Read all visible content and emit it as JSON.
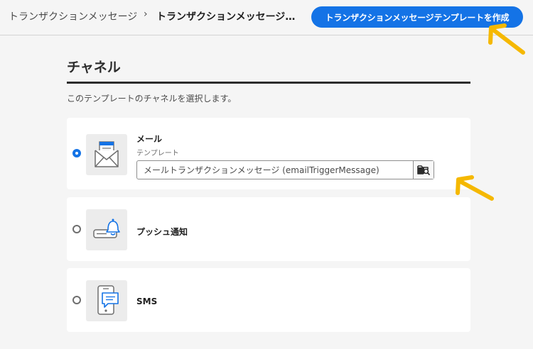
{
  "header": {
    "breadcrumb_root": "トランザクションメッセージ",
    "separator": "›",
    "breadcrumb_current": "トランザクションメッセージ...",
    "create_button_label": "トランザクションメッセージテンプレートを作成"
  },
  "section": {
    "title": "チャネル",
    "description": "このテンプレートのチャネルを選択します。"
  },
  "channels": [
    {
      "label": "メール",
      "sublabel": "テンプレート",
      "template_value": "メールトランザクションメッセージ (emailTriggerMessage)",
      "selected": true,
      "icon": "envelope-icon"
    },
    {
      "label": "プッシュ通知",
      "selected": false,
      "icon": "push-notification-icon"
    },
    {
      "label": "SMS",
      "selected": false,
      "icon": "sms-phone-icon"
    }
  ],
  "colors": {
    "accent": "#1473e6",
    "annotation_arrow": "#f5b800",
    "background": "#f5f5f5"
  }
}
